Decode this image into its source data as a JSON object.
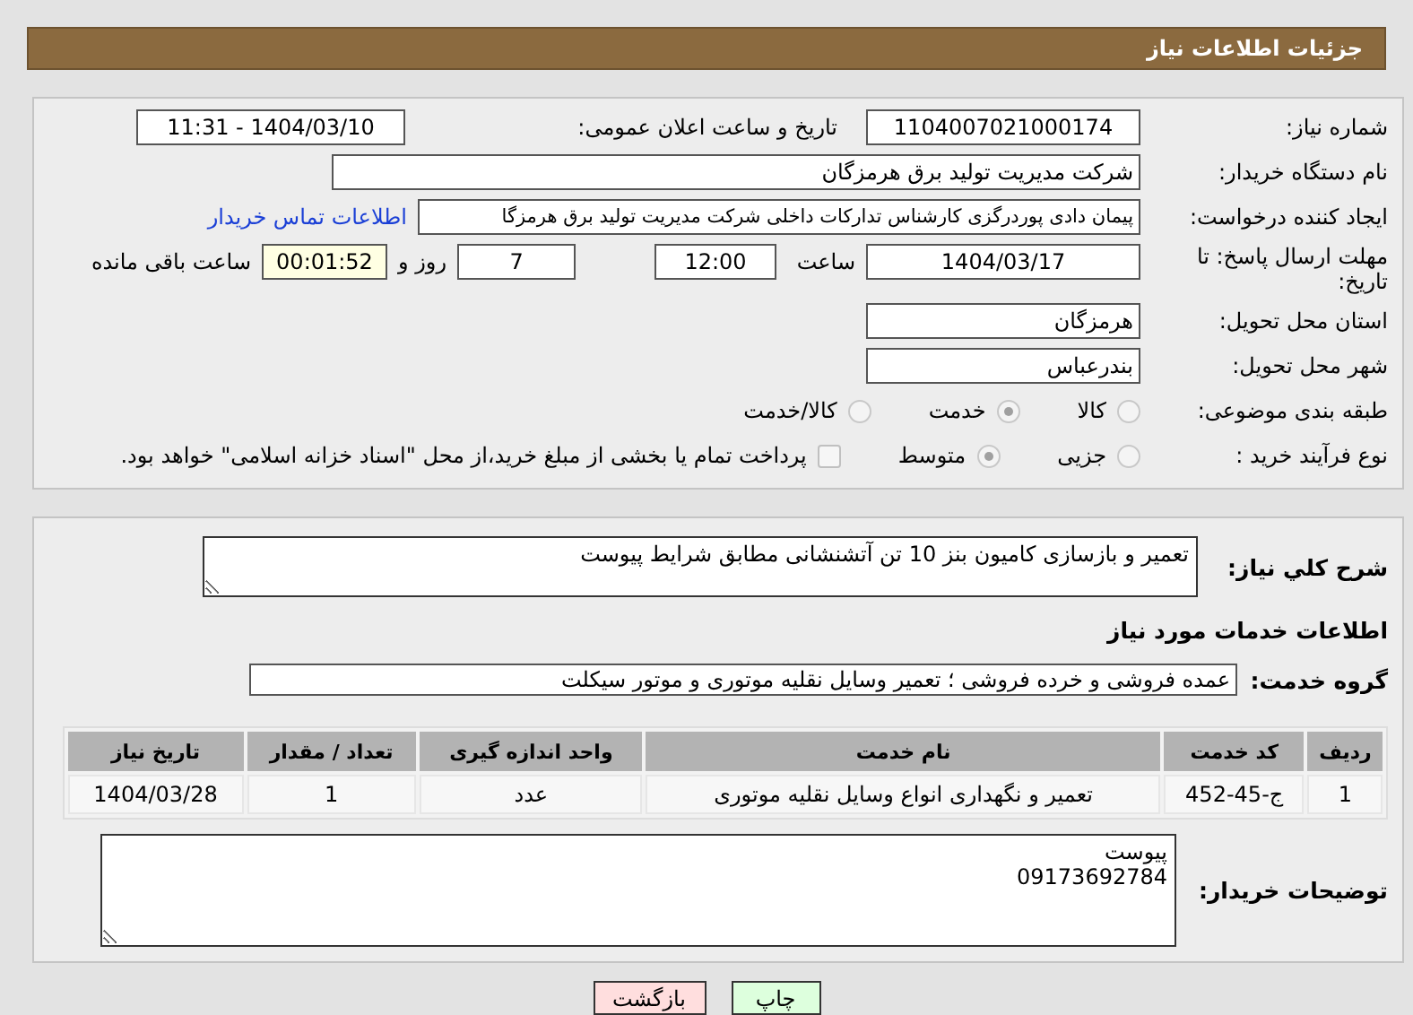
{
  "header": {
    "title": "جزئیات اطلاعات نیاز"
  },
  "need_number": {
    "label": "شماره نیاز:",
    "value": "1104007021000174"
  },
  "announce": {
    "label": "تاریخ و ساعت اعلان عمومی:",
    "value": "1404/03/10 - 11:31"
  },
  "buyer_org": {
    "label": "نام دستگاه خریدار:",
    "value": "شرکت مدیریت تولید برق هرمزگان"
  },
  "requester": {
    "label": "ایجاد کننده درخواست:",
    "value": "پیمان دادی پوردرگزی کارشناس تدارکات داخلی شرکت مدیریت تولید برق هرمزگا",
    "link": "اطلاعات تماس خریدار"
  },
  "deadline": {
    "label": "مهلت ارسال پاسخ: تا تاریخ:",
    "date": "1404/03/17",
    "time_label": "ساعت",
    "time": "12:00",
    "days": "7",
    "days_label": "روز و",
    "remaining": "00:01:52",
    "remaining_label": "ساعت باقی مانده"
  },
  "province": {
    "label": "استان محل تحویل:",
    "value": "هرمزگان"
  },
  "city": {
    "label": "شهر محل تحویل:",
    "value": "بندرعباس"
  },
  "category": {
    "label": "طبقه بندی موضوعی:",
    "options": [
      {
        "label": "کالا",
        "selected": false,
        "disabled": true
      },
      {
        "label": "خدمت",
        "selected": true,
        "disabled": true
      },
      {
        "label": "کالا/خدمت",
        "selected": false,
        "disabled": true
      }
    ]
  },
  "process": {
    "label": "نوع فرآیند خرید :",
    "options": [
      {
        "label": "جزیی",
        "selected": false,
        "disabled": true
      },
      {
        "label": "متوسط",
        "selected": true,
        "disabled": true
      }
    ],
    "checkbox": {
      "label": "پرداخت تمام یا بخشی از مبلغ خرید،از محل \"اسناد خزانه اسلامی\" خواهد بود.",
      "checked": false
    }
  },
  "description": {
    "label": "شرح کلي نياز:",
    "value": "تعمیر و بازسازی کامیون بنز 10 تن آتشنشانی مطابق شرایط پیوست"
  },
  "services_title": "اطلاعات خدمات مورد نیاز",
  "service_group": {
    "label": "گروه خدمت:",
    "value": "عمده فروشی و خرده فروشی ؛ تعمیر وسایل نقلیه موتوری و موتور سیکلت"
  },
  "table": {
    "columns": [
      "ردیف",
      "کد خدمت",
      "نام خدمت",
      "واحد اندازه گیری",
      "تعداد / مقدار",
      "تاریخ نیاز"
    ],
    "rows": [
      [
        "1",
        "ج-45-452",
        "تعمیر و نگهداری انواع وسایل نقلیه موتوری",
        "عدد",
        "1",
        "1404/03/28"
      ]
    ]
  },
  "buyer_notes": {
    "label": "توضیحات خریدار:",
    "lines": [
      "پیوست",
      "09173692784"
    ]
  },
  "buttons": [
    {
      "label": "چاپ",
      "kind": "print"
    },
    {
      "label": "بازگشت",
      "kind": "back"
    }
  ]
}
